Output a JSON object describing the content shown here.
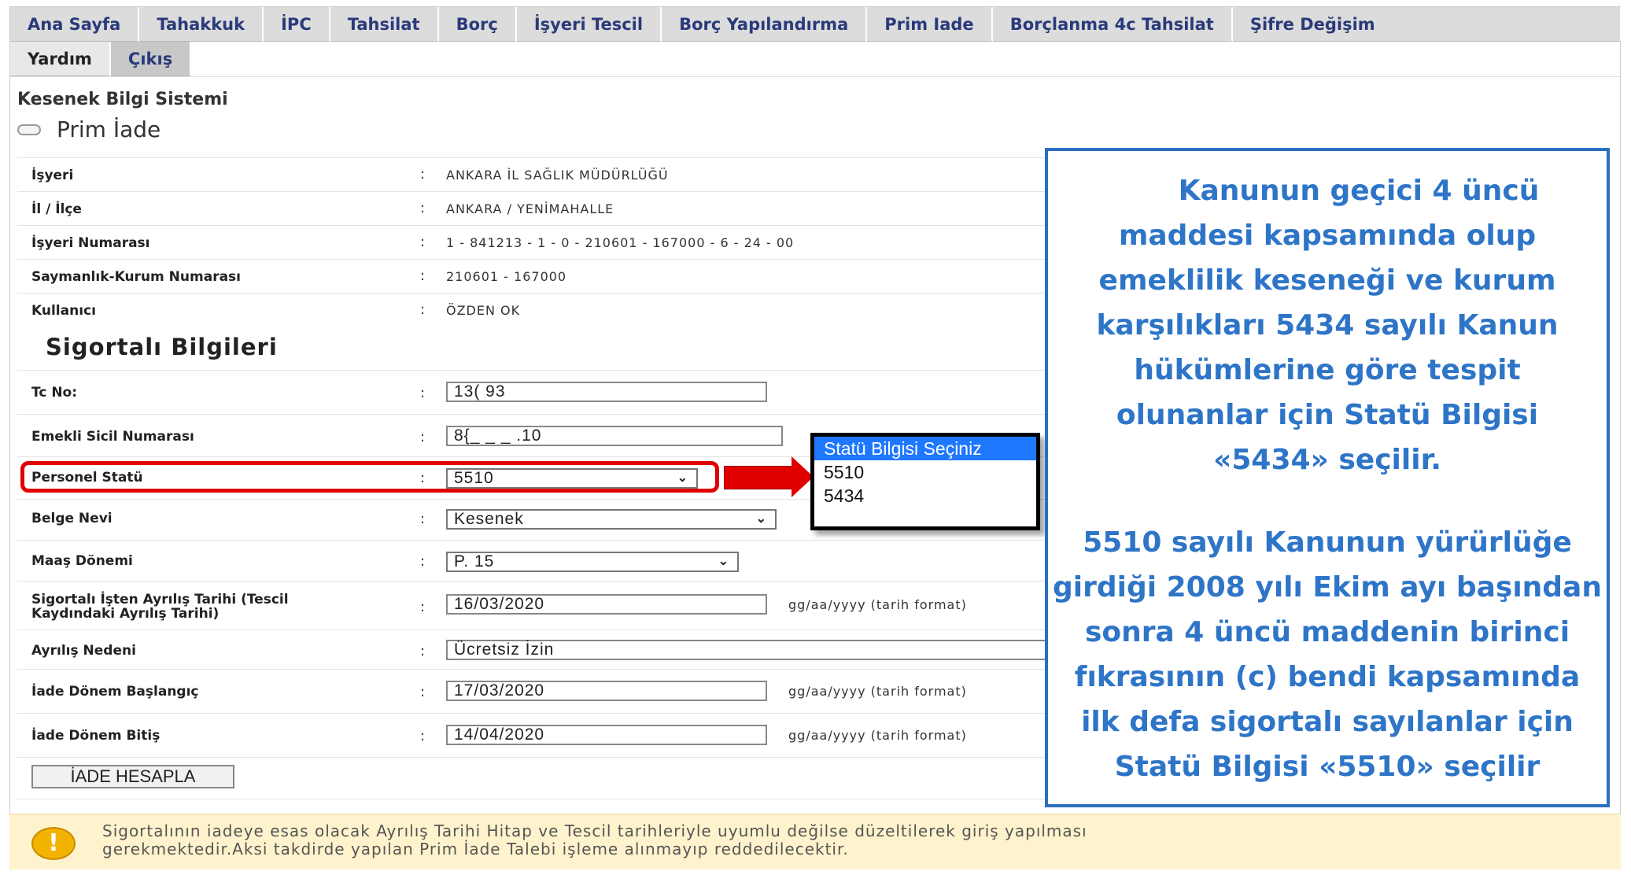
{
  "nav": {
    "row1": [
      "Ana Sayfa",
      "Tahakkuk",
      "İPC",
      "Tahsilat",
      "Borç",
      "İşyeri Tescil",
      "Borç Yapılandırma",
      "Prim Iade",
      "Borçlanma 4c Tahsilat",
      "Şifre Değişim"
    ],
    "row2": [
      "Yardım",
      "Çıkış"
    ]
  },
  "header": {
    "system_title": "Kesenek Bilgi Sistemi",
    "page_title": "Prim İade"
  },
  "info_rows": [
    {
      "label": "İşyeri",
      "value": "ANKARA İL SAĞLIK MÜDÜRLÜĞÜ"
    },
    {
      "label": "İl / İlçe",
      "value": "ANKARA / YENİMAHALLE"
    },
    {
      "label": "İşyeri Numarası",
      "value": "1 - 841213 - 1 - 0 - 210601 - 167000 - 6 - 24 - 00"
    },
    {
      "label": "Saymanlık-Kurum Numarası",
      "value": "210601 - 167000"
    },
    {
      "label": "Kullanıcı",
      "value": "ÖZDEN  OK"
    }
  ],
  "section_title": "Sigortalı Bilgileri",
  "form": {
    "colon": ":",
    "tc_label": "Tc No:",
    "tc_value": "13(            93",
    "sicil_label": "Emekli Sicil Numarası",
    "sicil_value": "8{_ _ _ .10",
    "statu_label": "Personel Statü",
    "statu_value": "5510",
    "belge_label": "Belge Nevi",
    "belge_value": "Kesenek",
    "maas_label": "Maaş Dönemi",
    "maas_value": "P. 15",
    "ayrilis_label_1": "Sigortalı İşten Ayrılış Tarihi (Tescil",
    "ayrilis_label_2": "Kaydındaki Ayrılış Tarihi)",
    "ayrilis_value": "16/03/2020",
    "neden_label": "Ayrılış Nedeni",
    "neden_value": "Ücretsiz İzin",
    "baslangic_label": "İade Dönem Başlangıç",
    "baslangic_value": "17/03/2020",
    "bitis_label": "İade Dönem Bitiş",
    "bitis_value": "14/04/2020",
    "date_hint": "gg/aa/yyyy (tarih format)",
    "button_label": "İADE HESAPLA"
  },
  "dropdown": {
    "options": [
      "Statü Bilgisi Seçiniz",
      "5510",
      "5434"
    ],
    "highlighted_index": 0
  },
  "info_box": {
    "para1": [
      "Kanunun geçici 4 üncü",
      "maddesi kapsamında olup",
      "emeklilik keseneği ve kurum",
      "karşılıkları 5434 sayılı Kanun",
      "hükümlerine göre tespit",
      "olunanlar için  Statü Bilgisi",
      "«5434» seçilir."
    ],
    "para2": [
      "5510 sayılı Kanunun yürürlüğe",
      "girdiği 2008 yılı Ekim ayı başından",
      "sonra 4 üncü maddenin birinci",
      "fıkrasının (c) bendi kapsamında",
      "ilk defa sigortalı sayılanlar için",
      "Statü Bilgisi «5510» seçilir"
    ]
  },
  "warning": {
    "icon": "!",
    "line1": "Sigortalının iadeye esas olacak Ayrılış Tarihi Hitap ve Tescil tarihleriyle uyumlu değilse düzeltilerek giriş yapılması",
    "line2": "gerekmektedir.Aksi takdirde yapılan Prim İade Talebi işleme alınmayıp reddedilecektir."
  },
  "colors": {
    "tab_bg": "#dcdcdc",
    "tab_text": "#2a3a7a",
    "highlight_red": "#e00000",
    "info_blue": "#2e75c7",
    "select_blue": "#1e78ff",
    "warning_bg": "#fff3cd"
  }
}
